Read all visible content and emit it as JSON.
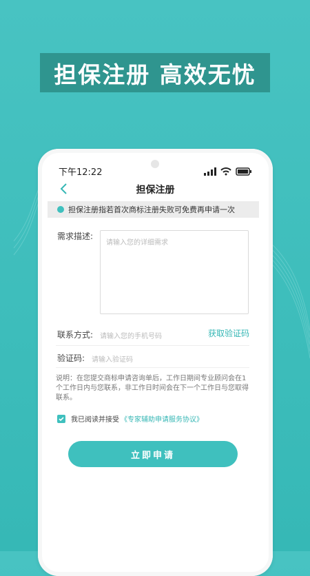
{
  "banner": {
    "text": "担保注册  高效无忧"
  },
  "status_bar": {
    "time": "下午12:22"
  },
  "header": {
    "title": "担保注册"
  },
  "notice": {
    "text": "担保注册指若首次商标注册失败可免费再申请一次"
  },
  "form": {
    "description_label": "需求描述:",
    "description_placeholder": "请输入您的详细需求",
    "contact_label": "联系方式:",
    "contact_placeholder": "请输入您的手机号码",
    "get_code_button": "获取验证码",
    "code_label": "验证码:",
    "code_placeholder": "请输入验证码",
    "explanation": "说明：在您提交商标申请咨询单后，工作日期间专业顾问会在1个工作日内与您联系，非工作日时间会在下一个工作日与您取得联系。",
    "agreement_text": "我已阅读并接受",
    "agreement_link": "《专家辅助申请服务协议》",
    "submit_button": "立即申请"
  },
  "colors": {
    "accent": "#3fc0be",
    "banner": "#2f958f"
  },
  "icons": [
    "back-icon",
    "signal-icon",
    "wifi-icon",
    "battery-icon",
    "checkbox-icon"
  ]
}
